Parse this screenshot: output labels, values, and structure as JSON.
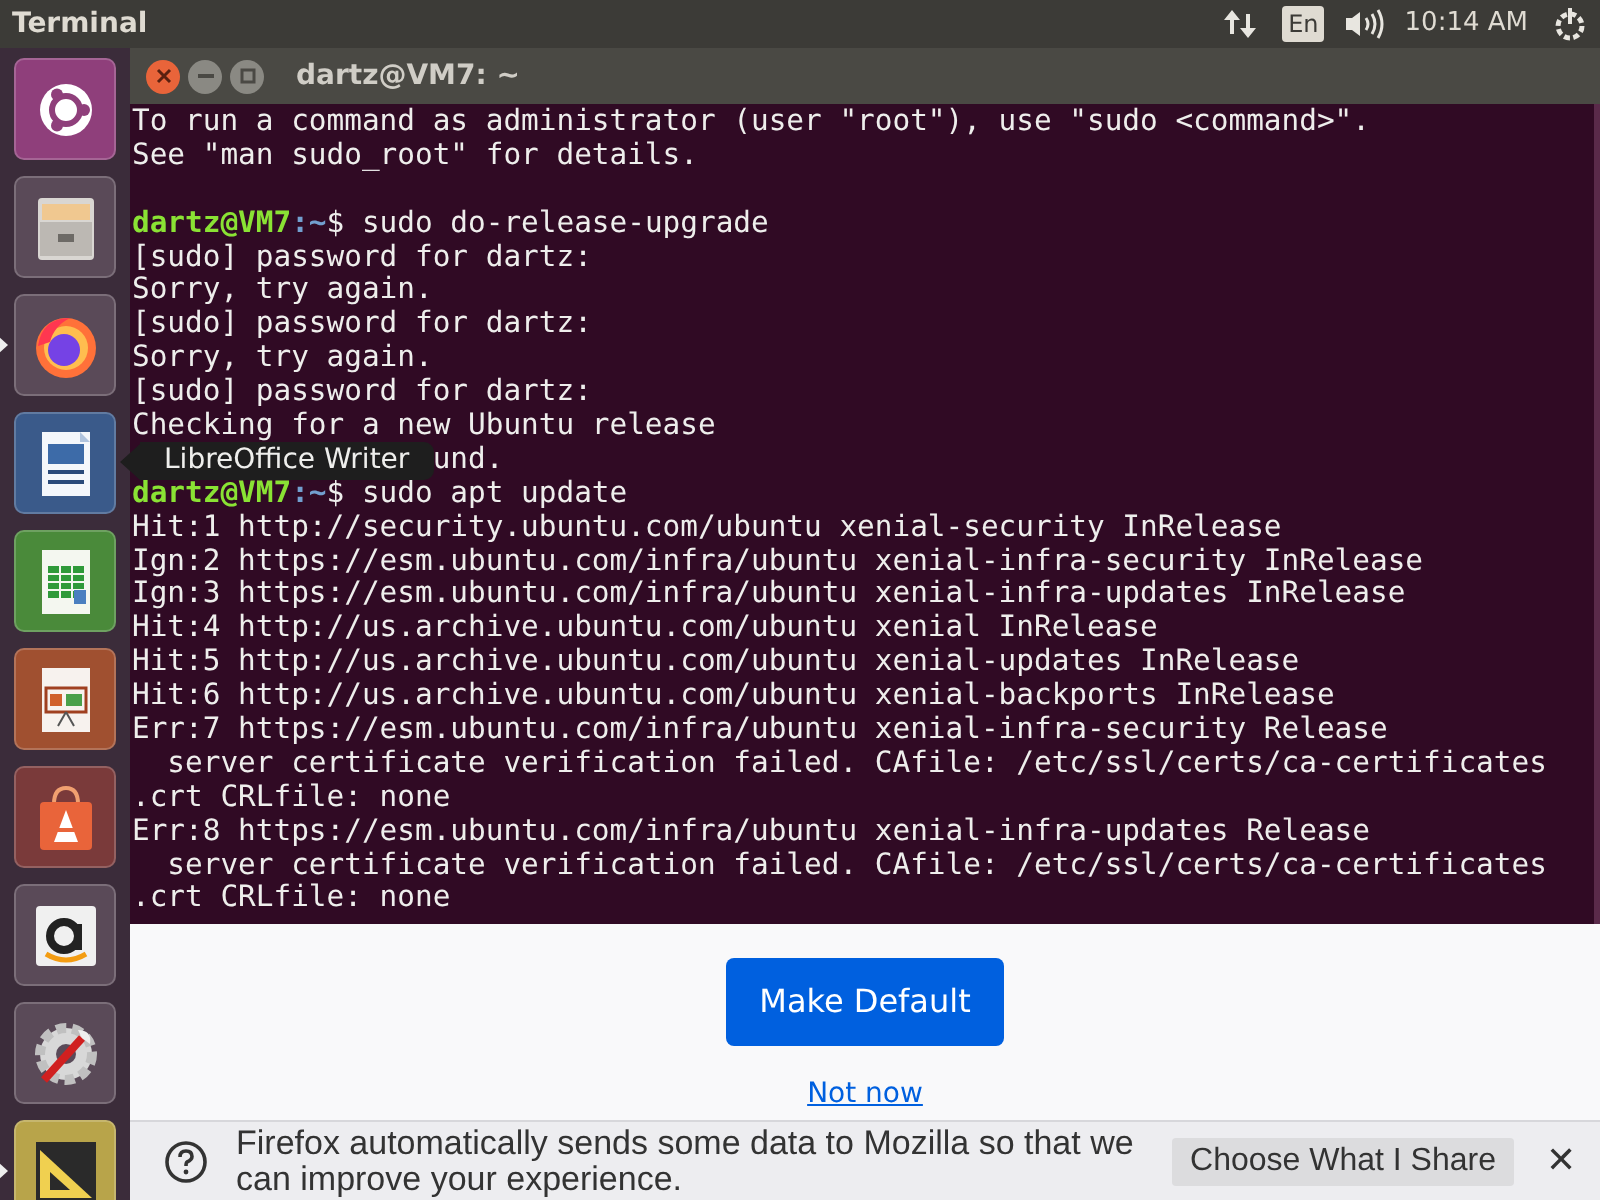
{
  "top_bar": {
    "title": "Terminal",
    "keyboard": "En",
    "clock": "10:14 AM"
  },
  "launcher": {
    "items": [
      {
        "kind": "ubuntu",
        "running": false
      },
      {
        "kind": "files",
        "running": false
      },
      {
        "kind": "firefox",
        "running": true
      },
      {
        "kind": "writer",
        "running": false
      },
      {
        "kind": "calc",
        "running": false
      },
      {
        "kind": "impress",
        "running": false
      },
      {
        "kind": "software",
        "running": false
      },
      {
        "kind": "amazon",
        "running": false
      },
      {
        "kind": "settings",
        "running": false
      },
      {
        "kind": "draw",
        "running": true
      }
    ],
    "tooltip": "LibreOffice Writer"
  },
  "terminal": {
    "title": "dartz@VM7: ~",
    "lines": [
      {
        "kind": "output",
        "text": "To run a command as administrator (user \"root\"), use \"sudo <command>\"."
      },
      {
        "kind": "output",
        "text": "See \"man sudo_root\" for details."
      },
      {
        "kind": "blank"
      },
      {
        "kind": "prompt",
        "user": "dartz@VM7",
        "path": ":~",
        "command": "$ sudo do-release-upgrade"
      },
      {
        "kind": "output",
        "text": "[sudo] password for dartz:"
      },
      {
        "kind": "output",
        "text": "Sorry, try again."
      },
      {
        "kind": "output",
        "text": "[sudo] password for dartz:"
      },
      {
        "kind": "output",
        "text": "Sorry, try again."
      },
      {
        "kind": "output",
        "text": "[sudo] password for dartz:"
      },
      {
        "kind": "output",
        "text": "Checking for a new Ubuntu release"
      },
      {
        "kind": "tail",
        "text": "und."
      },
      {
        "kind": "prompt",
        "user": "dartz@VM7",
        "path": ":~",
        "command": "$ sudo apt update"
      },
      {
        "kind": "output",
        "text": "Hit:1 http://security.ubuntu.com/ubuntu xenial-security InRelease"
      },
      {
        "kind": "output",
        "text": "Ign:2 https://esm.ubuntu.com/infra/ubuntu xenial-infra-security InRelease"
      },
      {
        "kind": "output",
        "text": "Ign:3 https://esm.ubuntu.com/infra/ubuntu xenial-infra-updates InRelease"
      },
      {
        "kind": "output",
        "text": "Hit:4 http://us.archive.ubuntu.com/ubuntu xenial InRelease"
      },
      {
        "kind": "output",
        "text": "Hit:5 http://us.archive.ubuntu.com/ubuntu xenial-updates InRelease"
      },
      {
        "kind": "output",
        "text": "Hit:6 http://us.archive.ubuntu.com/ubuntu xenial-backports InRelease"
      },
      {
        "kind": "output",
        "text": "Err:7 https://esm.ubuntu.com/infra/ubuntu xenial-infra-security Release"
      },
      {
        "kind": "output",
        "text": "  server certificate verification failed. CAfile: /etc/ssl/certs/ca-certificates"
      },
      {
        "kind": "output",
        "text": ".crt CRLfile: none"
      },
      {
        "kind": "output",
        "text": "Err:8 https://esm.ubuntu.com/infra/ubuntu xenial-infra-updates Release"
      },
      {
        "kind": "output",
        "text": "  server certificate verification failed. CAfile: /etc/ssl/certs/ca-certificates"
      },
      {
        "kind": "output",
        "text": ".crt CRLfile: none"
      }
    ]
  },
  "firefox": {
    "primary_button": "Make Default",
    "link": "Not now",
    "notification": {
      "message": "Firefox automatically sends some data to Mozilla so that we can improve your experience.",
      "button": "Choose What I Share",
      "close": "✕"
    }
  }
}
